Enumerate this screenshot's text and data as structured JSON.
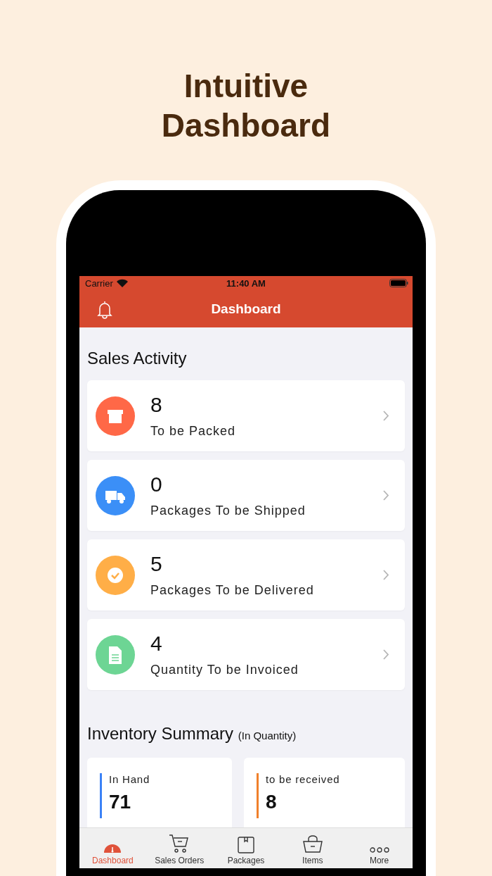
{
  "headline": "Intuitive Dashboard",
  "status_bar": {
    "carrier": "Carrier",
    "time": "11:40 AM"
  },
  "nav_bar": {
    "title": "Dashboard"
  },
  "sales_activity": {
    "title": "Sales Activity",
    "items": [
      {
        "kind": "packed",
        "color": "#ff6847",
        "count": "8",
        "label": "To be Packed"
      },
      {
        "kind": "shipped",
        "color": "#3b8ff7",
        "count": "0",
        "label": "Packages To be Shipped"
      },
      {
        "kind": "delivered",
        "color": "#ffae47",
        "count": "5",
        "label": "Packages To be Delivered"
      },
      {
        "kind": "invoiced",
        "color": "#6dd594",
        "count": "4",
        "label": "Quantity To be Invoiced"
      }
    ]
  },
  "inventory_summary": {
    "title": "Inventory Summary",
    "note": "(In Quantity)",
    "cards": [
      {
        "label": "In Hand",
        "value": "71",
        "color": "#3b82f6"
      },
      {
        "label": "to be received",
        "value": "8",
        "color": "#f0802b"
      }
    ]
  },
  "tab_bar": [
    {
      "kind": "dashboard",
      "label": "Dashboard",
      "selected": true
    },
    {
      "kind": "orders",
      "label": "Sales Orders",
      "selected": false
    },
    {
      "kind": "packages",
      "label": "Packages",
      "selected": false
    },
    {
      "kind": "items",
      "label": "Items",
      "selected": false
    },
    {
      "kind": "more",
      "label": "More",
      "selected": false
    }
  ]
}
